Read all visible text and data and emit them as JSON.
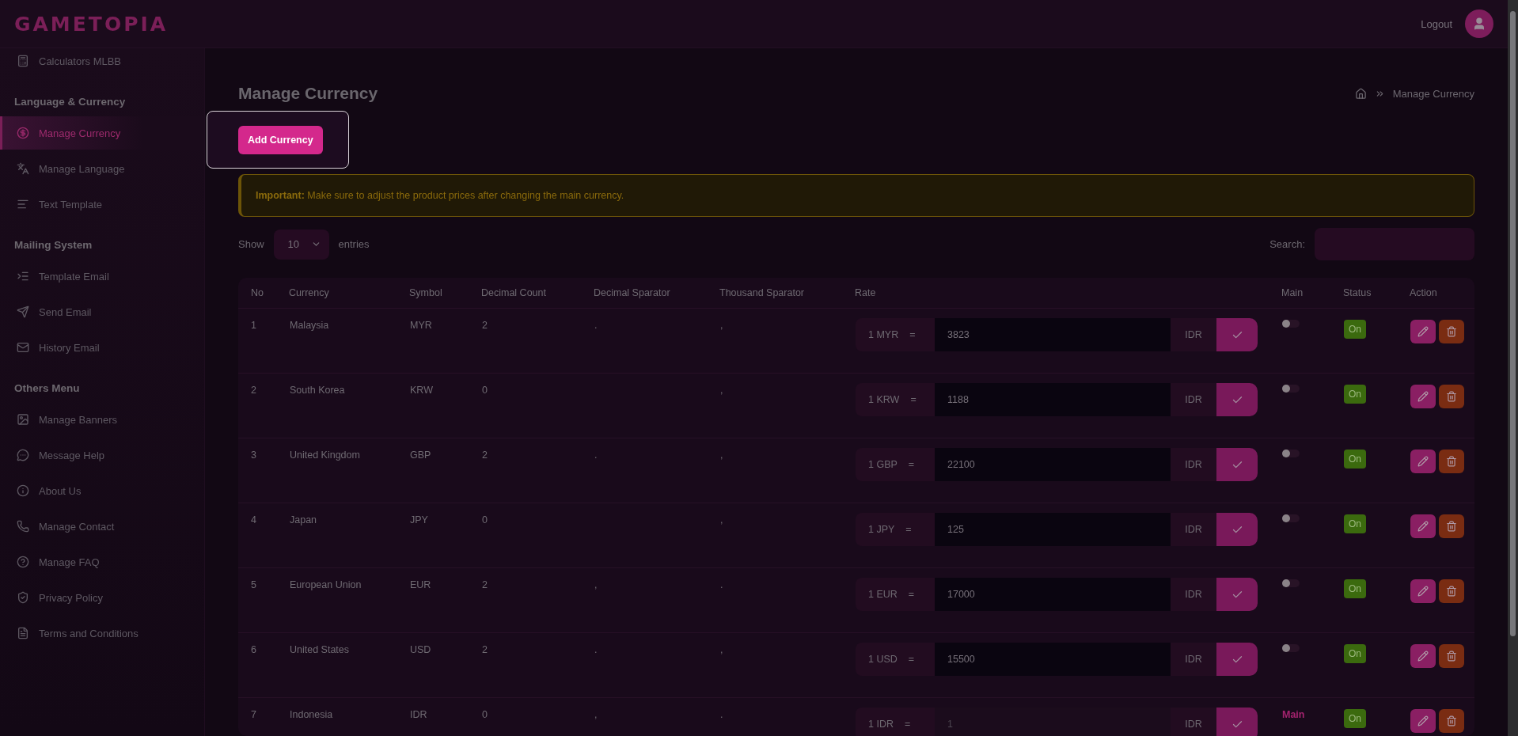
{
  "brand": "GAMETOPIA",
  "header": {
    "logout": "Logout"
  },
  "sidebar": {
    "sections": [
      {
        "items": [
          {
            "label": "Calculators MLBB",
            "selected": false
          }
        ]
      },
      {
        "title": "Language & Currency",
        "items": [
          {
            "label": "Manage Currency",
            "selected": true
          },
          {
            "label": "Manage Language",
            "selected": false
          },
          {
            "label": "Text Template",
            "selected": false
          }
        ]
      },
      {
        "title": "Mailing System",
        "items": [
          {
            "label": "Template Email",
            "selected": false
          },
          {
            "label": "Send Email",
            "selected": false
          },
          {
            "label": "History Email",
            "selected": false
          }
        ]
      },
      {
        "title": "Others Menu",
        "items": [
          {
            "label": "Manage Banners",
            "selected": false
          },
          {
            "label": "Message Help",
            "selected": false
          },
          {
            "label": "About Us",
            "selected": false
          },
          {
            "label": "Manage Contact",
            "selected": false
          },
          {
            "label": "Manage FAQ",
            "selected": false
          },
          {
            "label": "Privacy Policy",
            "selected": false
          },
          {
            "label": "Terms and Conditions",
            "selected": false
          }
        ]
      }
    ]
  },
  "page": {
    "title": "Manage Currency",
    "breadcrumb": "Manage Currency",
    "add_button": "Add Currency"
  },
  "alert": {
    "text": "**Important:** Make sure to adjust the product prices after changing the main currency."
  },
  "table_controls": {
    "show": "Show",
    "page_size": "10",
    "entries": "entries",
    "search_label": "Search:"
  },
  "table": {
    "columns": [
      "No",
      "Currency",
      "Symbol",
      "Decimal Count",
      "Decimal Sparator",
      "Thousand Sparator",
      "Rate",
      "Main",
      "Status",
      "Action"
    ],
    "rows": [
      {
        "no": "1",
        "currency": "Malaysia",
        "symbol": "MYR",
        "decimal_count": "2",
        "decimal_separator": ".",
        "thousand_separator": ",",
        "rate_label": "1 MYR",
        "equals": "=",
        "rate": "3823",
        "target": "IDR",
        "rate_disabled": false,
        "main": {
          "kind": "toggle",
          "on": false
        },
        "status": {
          "text": "On",
          "on": true
        }
      },
      {
        "no": "2",
        "currency": "South Korea",
        "symbol": "KRW",
        "decimal_count": "0",
        "thousand_separator": ",",
        "rate_label": "1 KRW",
        "equals": "=",
        "rate": "1188",
        "target": "IDR",
        "rate_disabled": false,
        "main": {
          "kind": "toggle",
          "on": false
        },
        "status": {
          "text": "On",
          "on": true
        }
      },
      {
        "no": "3",
        "currency": "United Kingdom",
        "symbol": "GBP",
        "decimal_count": "2",
        "decimal_separator": ".",
        "thousand_separator": ",",
        "rate_label": "1 GBP",
        "equals": "=",
        "rate": "22100",
        "target": "IDR",
        "rate_disabled": false,
        "main": {
          "kind": "toggle",
          "on": false
        },
        "status": {
          "text": "On",
          "on": true
        }
      },
      {
        "no": "4",
        "currency": "Japan",
        "symbol": "JPY",
        "decimal_count": "0",
        "thousand_separator": ",",
        "rate_label": "1 JPY",
        "equals": "=",
        "rate": "125",
        "target": "IDR",
        "rate_disabled": false,
        "main": {
          "kind": "toggle",
          "on": false
        },
        "status": {
          "text": "On",
          "on": true
        }
      },
      {
        "no": "5",
        "currency": "European Union",
        "symbol": "EUR",
        "decimal_count": "2",
        "decimal_separator": ",",
        "thousand_separator": ".",
        "rate_label": "1 EUR",
        "equals": "=",
        "rate": "17000",
        "target": "IDR",
        "rate_disabled": false,
        "main": {
          "kind": "toggle",
          "on": false
        },
        "status": {
          "text": "On",
          "on": true
        }
      },
      {
        "no": "6",
        "currency": "United States",
        "symbol": "USD",
        "decimal_count": "2",
        "decimal_separator": ".",
        "thousand_separator": ",",
        "rate_label": "1 USD",
        "equals": "=",
        "rate": "15500",
        "target": "IDR",
        "rate_disabled": false,
        "main": {
          "kind": "toggle",
          "on": false
        },
        "status": {
          "text": "On",
          "on": true
        }
      },
      {
        "no": "7",
        "currency": "Indonesia",
        "symbol": "IDR",
        "decimal_count": "0",
        "decimal_separator": ",",
        "thousand_separator": ".",
        "rate_label": "1 IDR",
        "equals": "=",
        "rate": "1",
        "target": "IDR",
        "rate_disabled": true,
        "main": {
          "kind": "label",
          "text": "Main"
        },
        "status": {
          "text": "On",
          "on": true
        }
      }
    ]
  }
}
